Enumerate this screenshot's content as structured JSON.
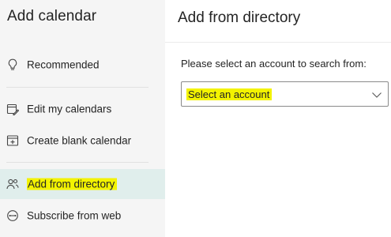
{
  "sidebar": {
    "title": "Add calendar",
    "items": [
      {
        "label": "Recommended",
        "icon": "lightbulb-icon"
      },
      {
        "label": "Edit my calendars",
        "icon": "edit-calendar-icon"
      },
      {
        "label": "Create blank calendar",
        "icon": "add-calendar-icon"
      },
      {
        "label": "Add from directory",
        "icon": "people-search-icon",
        "selected": true
      },
      {
        "label": "Subscribe from web",
        "icon": "globe-link-icon"
      }
    ]
  },
  "main": {
    "title": "Add from directory",
    "prompt": "Please select an account to search from:",
    "account_select": {
      "value": "Select an account",
      "icon": "chevron-down-icon"
    }
  },
  "colors": {
    "sidebar_bg": "#f5f5f5",
    "selected_bg": "#e0eeec",
    "highlight": "#f3f300"
  }
}
